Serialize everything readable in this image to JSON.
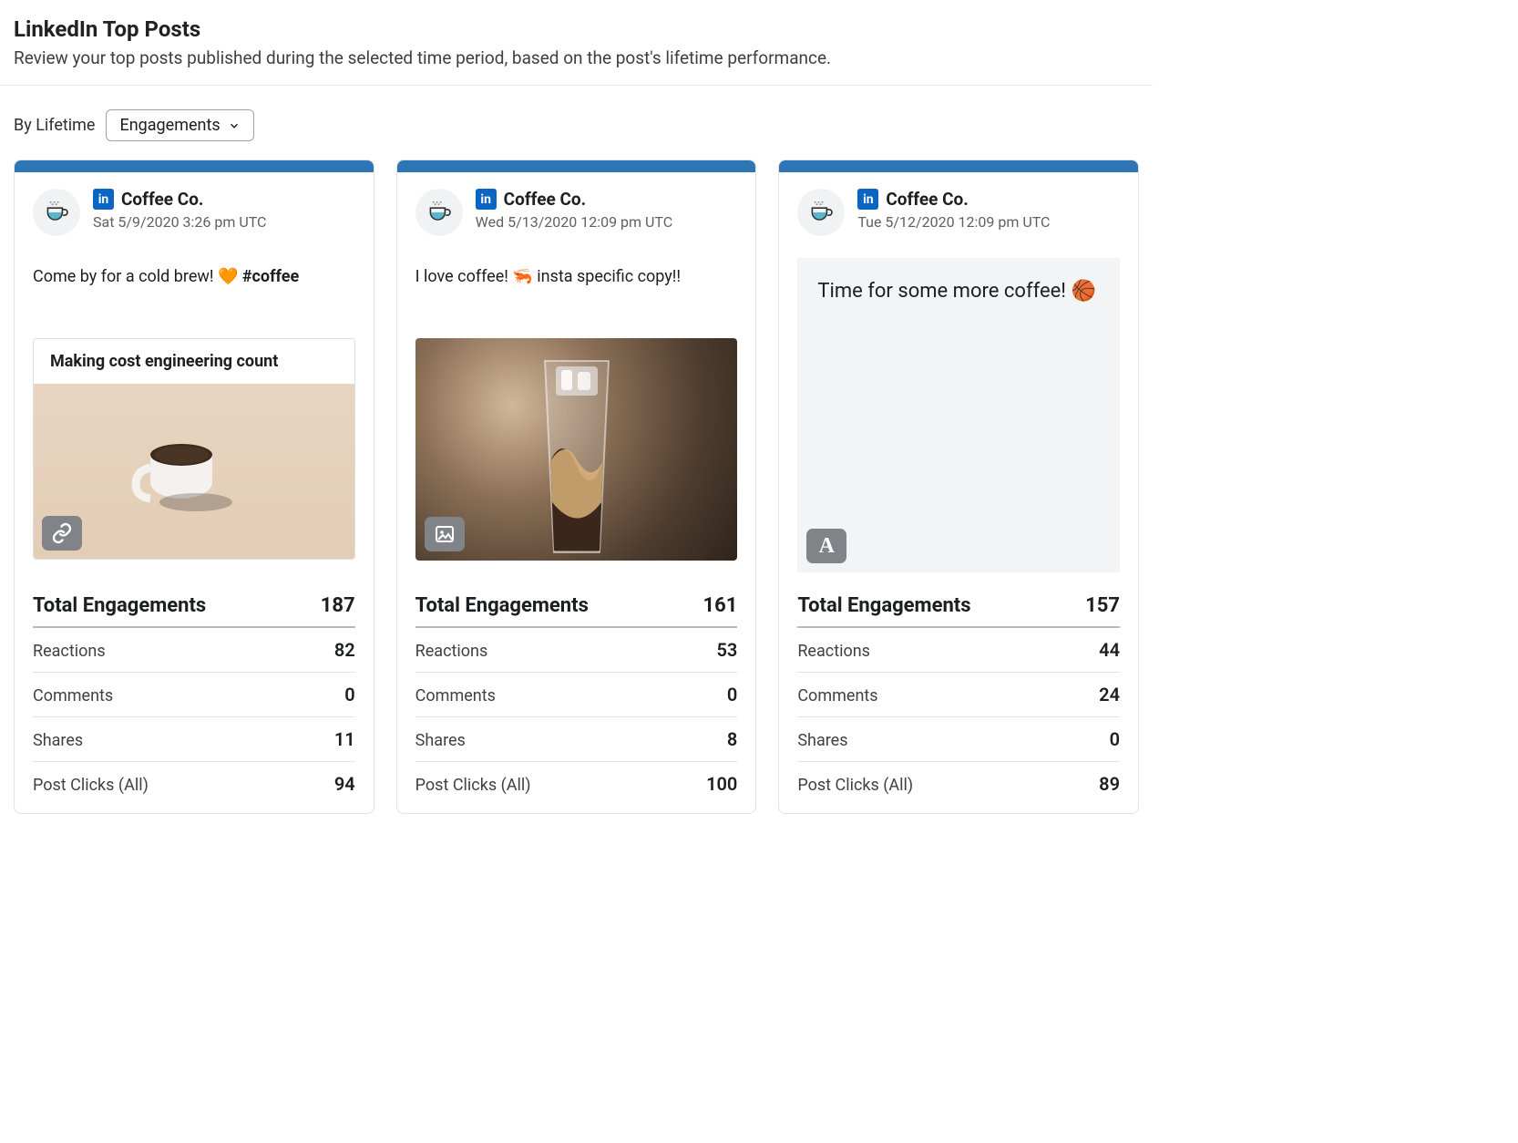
{
  "header": {
    "title": "LinkedIn Top Posts",
    "subtitle": "Review your top posts published during the selected time period, based on the post's lifetime performance."
  },
  "filter": {
    "label": "By Lifetime",
    "selected": "Engagements"
  },
  "metric_labels": {
    "total_engagements": "Total Engagements",
    "reactions": "Reactions",
    "comments": "Comments",
    "shares": "Shares",
    "post_clicks": "Post Clicks (All)"
  },
  "posts": [
    {
      "network_badge": "in",
      "company": "Coffee Co.",
      "timestamp": "Sat 5/9/2020 3:26 pm UTC",
      "text": "Come by for a cold brew! 🧡  ",
      "hashtag": "#coffee",
      "media_type": "link",
      "link_title": "Making cost engineering count",
      "metrics": {
        "total_engagements": "187",
        "reactions": "82",
        "comments": "0",
        "shares": "11",
        "post_clicks": "94"
      }
    },
    {
      "network_badge": "in",
      "company": "Coffee Co.",
      "timestamp": "Wed 5/13/2020 12:09 pm UTC",
      "text": "I love coffee! 🦐  insta specific copy!!",
      "hashtag": "",
      "media_type": "photo",
      "metrics": {
        "total_engagements": "161",
        "reactions": "53",
        "comments": "0",
        "shares": "8",
        "post_clicks": "100"
      }
    },
    {
      "network_badge": "in",
      "company": "Coffee Co.",
      "timestamp": "Tue 5/12/2020 12:09 pm UTC",
      "text": "",
      "hashtag": "",
      "media_type": "text",
      "text_media": "Time for some more coffee! 🏀",
      "metrics": {
        "total_engagements": "157",
        "reactions": "44",
        "comments": "24",
        "shares": "0",
        "post_clicks": "89"
      }
    }
  ],
  "colors": {
    "card_accent": "#2e75b6",
    "linkedin": "#0a66c2"
  }
}
